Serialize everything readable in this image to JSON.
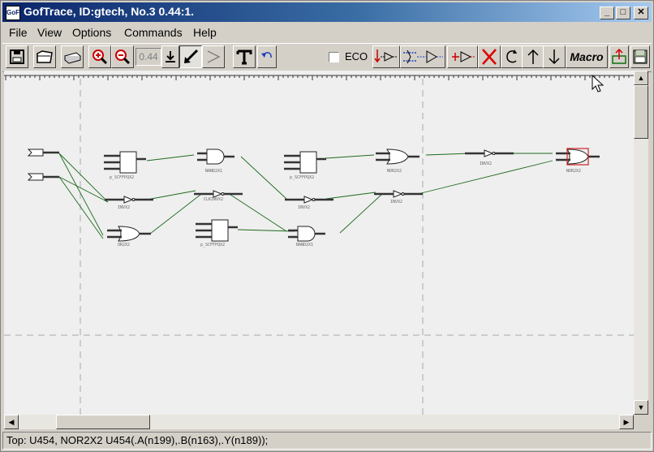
{
  "window": {
    "title": "GofTrace, ID:gtech, No.3 0.44:1.",
    "icon_text": "GoF",
    "controls": {
      "minimize": "_",
      "maximize": "□",
      "close": "✕"
    }
  },
  "menu": [
    "File",
    "View",
    "Options",
    "Commands",
    "Help"
  ],
  "toolbar": {
    "zoom_value": "0.44",
    "eco_label": "ECO",
    "eco_checked": false,
    "macro_label": "Macro",
    "tools": [
      "save-icon",
      "open-icon",
      "print-icon",
      "zoom-in-icon",
      "zoom-out-icon",
      "zoom-value",
      "download-arrow-icon",
      "pointer-arrow-icon",
      "wire-icon",
      "text-tool-icon",
      "undo-icon"
    ],
    "trace_tools": [
      "trace-fanin-icon",
      "trace-path-icon",
      "trace-fanout-icon",
      "delete-icon",
      "refresh-icon",
      "up-arrow-icon",
      "down-arrow-icon",
      "macro-button",
      "export-icon",
      "save-db-icon"
    ]
  },
  "schematic": {
    "cells": [
      "p_SCFFPQX2",
      "NAND2X1",
      "p_SCFFPQX2",
      "NOR2X2",
      "INVX2",
      "NOR2X2",
      "INVX2",
      "CLKINVX2",
      "INVX2",
      "INVX2",
      "OR2X2",
      "p_SCFFPQX2",
      "NAND2X1"
    ],
    "selected_cell": "NOR2X2",
    "colors": {
      "wire": "#1d6b1d",
      "gate": "#222222",
      "pin": "#333333",
      "selected": "#cc2222",
      "canvas": "#efefef"
    }
  },
  "status": "Top: U454, NOR2X2 U454(.A(n199),.B(n163),.Y(n189));"
}
